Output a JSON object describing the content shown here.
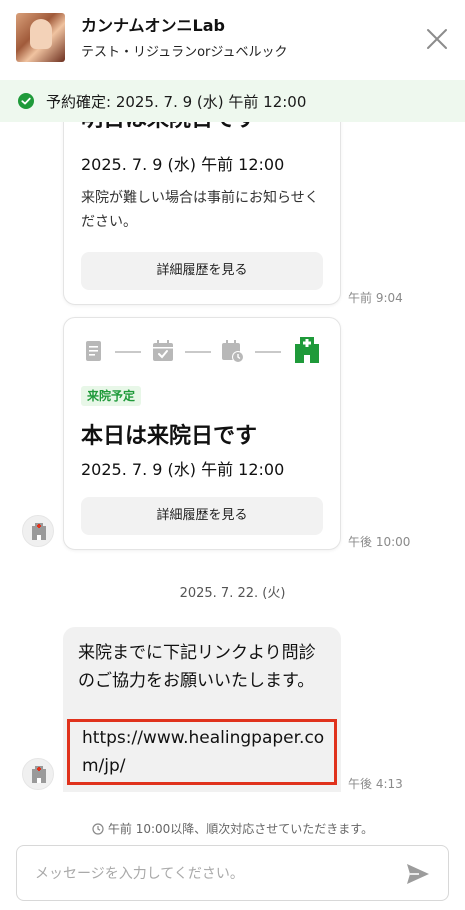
{
  "header": {
    "shop_name": "カンナムオンニLab",
    "subtitle": "テスト・リジュランorジュベルック",
    "close_icon": "close-icon"
  },
  "banner": {
    "text": "予約確定: 2025. 7. 9 (水) 午前 12:00",
    "icon": "check-circle-icon",
    "color": "#1f9a3a"
  },
  "messages": {
    "card1": {
      "title": "明日は来院日です",
      "date": "2025. 7. 9 (水) 午前 12:00",
      "note": "来院が難しい場合は事前にお知らせください。",
      "button": "詳細履歴を見る",
      "time": "午前 9:04"
    },
    "card2": {
      "badge": "来院予定",
      "title": "本日は来院日です",
      "date": "2025. 7. 9 (水) 午前 12:00",
      "button": "詳細履歴を見る",
      "time": "午後 10:00",
      "step_icons": [
        "document-icon",
        "calendar-check-icon",
        "calendar-clock-icon",
        "hospital-icon"
      ]
    },
    "date_divider": "2025. 7. 22. (火)",
    "text_message": {
      "body": "来院までに下記リンクより問診のご協力をお願いいたします。",
      "link": "https://www.healingpaper.com/jp/",
      "time": "午後 4:13"
    }
  },
  "notice": "午前 10:00以降、順次対応させていただきます。",
  "composer": {
    "placeholder": "メッセージを入力してください。",
    "value": "",
    "send_icon": "send-icon"
  },
  "colors": {
    "accent_green": "#1f9a3a",
    "banner_bg": "#eef8ee",
    "highlight_red": "#e0321c"
  }
}
